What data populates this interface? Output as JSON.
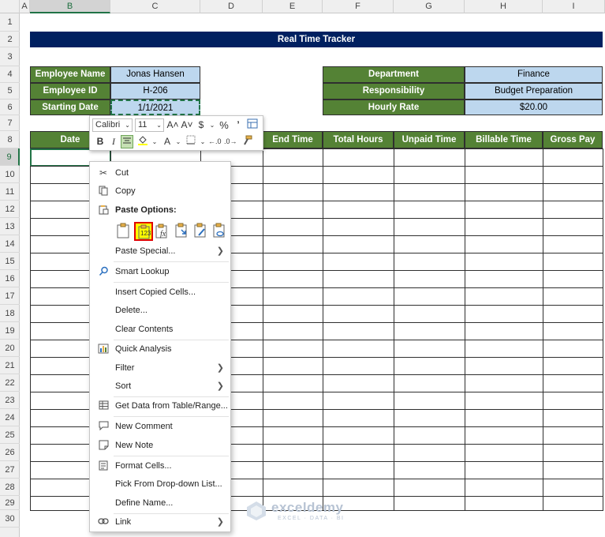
{
  "columns": [
    "A",
    "B",
    "C",
    "D",
    "E",
    "F",
    "G",
    "H",
    "I"
  ],
  "rows": [
    "1",
    "2",
    "3",
    "4",
    "5",
    "6",
    "7",
    "8",
    "9",
    "10",
    "11",
    "12",
    "13",
    "14",
    "15",
    "16",
    "17",
    "18",
    "19",
    "20",
    "21",
    "22",
    "23",
    "24",
    "25",
    "26",
    "27",
    "28",
    "29",
    "30"
  ],
  "sheet": {
    "title": "Real Time Tracker",
    "employee_name_label": "Employee Name",
    "employee_name_value": "Jonas Hansen",
    "employee_id_label": "Employee ID",
    "employee_id_value": "H-206",
    "starting_date_label": "Starting Date",
    "starting_date_value": "1/1/2021",
    "department_label": "Department",
    "department_value": "Finance",
    "responsibility_label": "Responsibility",
    "responsibility_value": "Budget Preparation",
    "hourly_rate_label": "Hourly Rate",
    "hourly_rate_value": "$20.00",
    "table_headers": {
      "date": "Date",
      "end_time": "End Time",
      "total_hours": "Total Hours",
      "unpaid_time": "Unpaid Time",
      "billable_time": "Billable Time",
      "gross_pay": "Gross Pay"
    }
  },
  "mini_toolbar": {
    "font_name": "Calibri",
    "font_size": "11",
    "increase_font": "A˄",
    "decrease_font": "A˅",
    "currency": "$",
    "percent": "%",
    "comma": "’",
    "bold": "B",
    "italic": "I",
    "font_color": "A"
  },
  "context_menu": {
    "cut": "Cut",
    "copy": "Copy",
    "paste_options": "Paste Options:",
    "paste_special": "Paste Special...",
    "smart_lookup": "Smart Lookup",
    "insert_copied_cells": "Insert Copied Cells...",
    "delete": "Delete...",
    "clear_contents": "Clear Contents",
    "quick_analysis": "Quick Analysis",
    "filter": "Filter",
    "sort": "Sort",
    "get_data": "Get Data from Table/Range...",
    "new_comment": "New Comment",
    "new_note": "New Note",
    "format_cells": "Format Cells...",
    "pick_from_list": "Pick From Drop-down List...",
    "define_name": "Define Name...",
    "link": "Link",
    "paste_values_badge": "123"
  },
  "watermark": {
    "brand": "exceldemy",
    "tagline": "EXCEL · DATA · BI"
  },
  "colors": {
    "green": "#548235",
    "navy": "#002060",
    "light_blue": "#bdd7ee",
    "highlight": "#ffff00",
    "accent": "#217346"
  }
}
